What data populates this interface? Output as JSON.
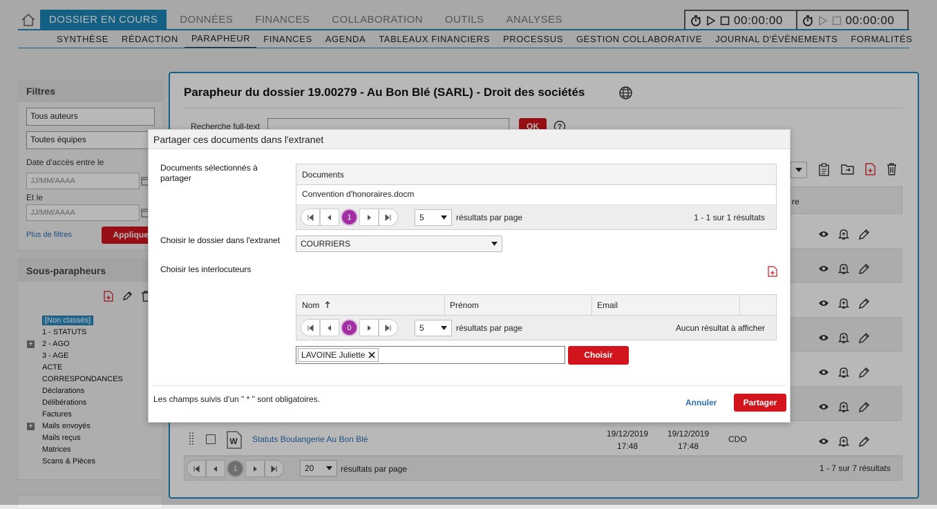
{
  "nav": {
    "main_tabs": [
      "DOSSIER EN COURS",
      "DONNÉES",
      "FINANCES",
      "COLLABORATION",
      "OUTILS",
      "ANALYSES"
    ],
    "sub_tabs": [
      "SYNTHÈSE",
      "RÉDACTION",
      "PARAPHEUR",
      "FINANCES",
      "AGENDA",
      "TABLEAUX FINANCIERS",
      "PROCESSUS",
      "GESTION COLLABORATIVE",
      "JOURNAL D'ÉVÈNEMENTS",
      "FORMALITÉS"
    ],
    "timers": [
      "00:00:00",
      "00:00:00"
    ]
  },
  "filters": {
    "title": "Filtres",
    "authors": "Tous auteurs",
    "teams": "Toutes équipes",
    "date_label": "Date d'accès entre le",
    "date_placeholder": "JJ/MM/AAAA",
    "and_label": "Et le",
    "more_filters": "Plus de filtres",
    "apply": "Appliquer"
  },
  "subparapheurs": {
    "title": "Sous-parapheurs",
    "items": [
      "[Non classés]",
      "1 - STATUTS",
      "2 - AGO",
      "3 - AGE",
      "ACTE",
      "CORRESPONDANCES",
      "Déclarations",
      "Délibérations",
      "Factures",
      "Mails envoyés",
      "Mails reçus",
      "Matrices",
      "Scans & Pièces"
    ]
  },
  "main": {
    "title": "Parapheur du dossier 19.00279 - Au Bon Blé (SARL) - Droit des sociétés",
    "search_label": "Recherche full-text",
    "ok": "OK",
    "col_partial": "re",
    "last_row": {
      "name": "Statuts Boulangerie Au Bon Blé",
      "date1": "19/12/2019",
      "time1": "17:48",
      "date2": "19/12/2019",
      "time2": "17:48",
      "author": "CDO"
    },
    "pager": {
      "page": "1",
      "per_page": "20",
      "per_page_label": "résultats par page",
      "summary": "1 - 7 sur 7 résultats"
    }
  },
  "modal": {
    "title": "Partager ces documents dans l'extranet",
    "docs_label": "Documents sélectionnés à partager",
    "docs_col": "Documents",
    "docs": [
      "Convention d'honoraires.docm"
    ],
    "docs_pager": {
      "page": "1",
      "per_page": "5",
      "per_page_label": "résultats par page",
      "summary": "1 - 1 sur 1 résultats"
    },
    "folder_label": "Choisir le dossier dans l'extranet",
    "folder_value": "COURRIERS",
    "contacts_label": "Choisir les interlocuteurs",
    "contacts_cols": [
      "Nom",
      "Prénom",
      "Email"
    ],
    "contacts_pager": {
      "page": "0",
      "per_page": "5",
      "per_page_label": "résultats par page",
      "summary": "Aucun résultat à afficher"
    },
    "chip": "LAVOINE Juliette",
    "choose": "Choisir",
    "required_note": "Les champs suivis d'un \" * \" sont obligatoires.",
    "cancel": "Annuler",
    "share": "Partager"
  },
  "colors": {
    "accent": "#1b86b8",
    "danger": "#d2141c",
    "pager_active": "#a12ea2"
  }
}
